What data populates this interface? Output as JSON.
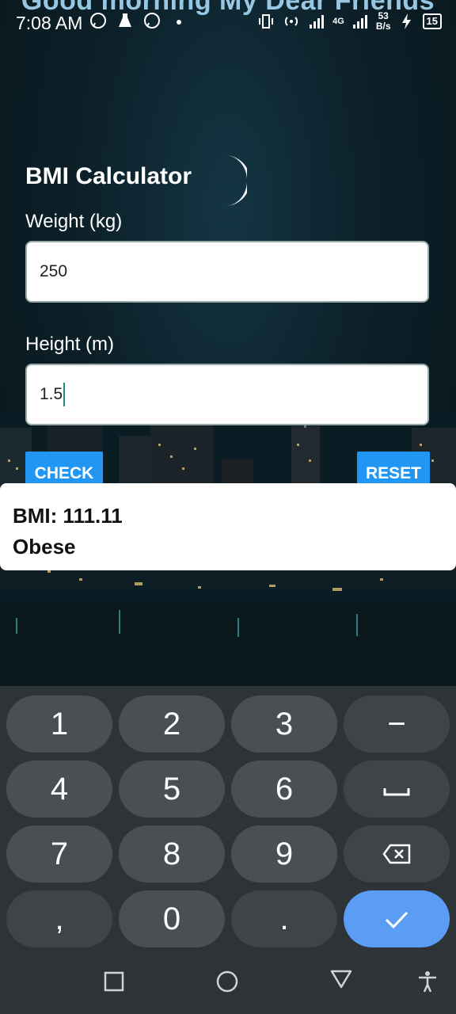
{
  "status_bar": {
    "time": "7:08 AM",
    "netspeed_value": "53",
    "netspeed_unit": "B/s",
    "network_type": "4G",
    "battery": "15",
    "icons_left": [
      "whatsapp-icon",
      "lab-flask-icon",
      "whatsapp-icon",
      "dot-icon"
    ],
    "icons_right": [
      "vibrate-icon",
      "hotspot-icon",
      "signal-icon",
      "signal-icon",
      "charging-icon",
      "battery-icon"
    ]
  },
  "banner": {
    "text": "Good morning My Dear Friends"
  },
  "app": {
    "title": "BMI Calculator",
    "weight_label": "Weight (kg)",
    "weight_value": "250",
    "height_label": "Height (m)",
    "height_value": "1.5",
    "check_label": "CHECK",
    "reset_label": "RESET",
    "accent": "#2196f3"
  },
  "result": {
    "bmi_text": "BMI: 111.11",
    "category_text": "Obese"
  },
  "keyboard": {
    "rows": [
      [
        "1",
        "2",
        "3",
        "−"
      ],
      [
        "4",
        "5",
        "6",
        "␣"
      ],
      [
        "7",
        "8",
        "9",
        "⌫"
      ],
      [
        ",",
        "0",
        ".",
        "✓"
      ]
    ],
    "done_color": "#5b9cf5"
  },
  "nav": [
    "recent-apps-icon",
    "home-icon",
    "back-icon",
    "accessibility-icon"
  ]
}
